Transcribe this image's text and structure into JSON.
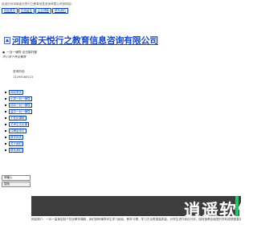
{
  "header": {
    "welcome": "欢迎访问河南省天悦行之教育信息咨询有限公司官网站!",
    "links": [
      "网站首页",
      "在线留言",
      "企业博客",
      "联系我们"
    ]
  },
  "site": {
    "title": "河南省天悦行之教育信息咨询有限公司",
    "tagline": "一对一辅导·全日制托管",
    "subtitle": "中小学个性化教育",
    "contact_label": "咨询热线:",
    "phone": "13295080523"
  },
  "nav": {
    "items": [
      "网站首页",
      "小学一对一辅导",
      "初中一对一辅导",
      "高中一对一辅导",
      "个性化课程",
      "艺考生文化课",
      "口碑及评价",
      "教学师资",
      "关于我们",
      "联系我们"
    ]
  },
  "search": {
    "input_value": "请输入",
    "button_label": "搜索"
  },
  "banner": {
    "text": "逍遥软件"
  },
  "description": {
    "text": "网站简介：一对一量身定制个性化教学课程，我们拥有辅导学生学习经验，教学习理，学习方法再提高质量，对学生进行综合分析，因材施教全面提升学科成绩提高学习效率"
  }
}
